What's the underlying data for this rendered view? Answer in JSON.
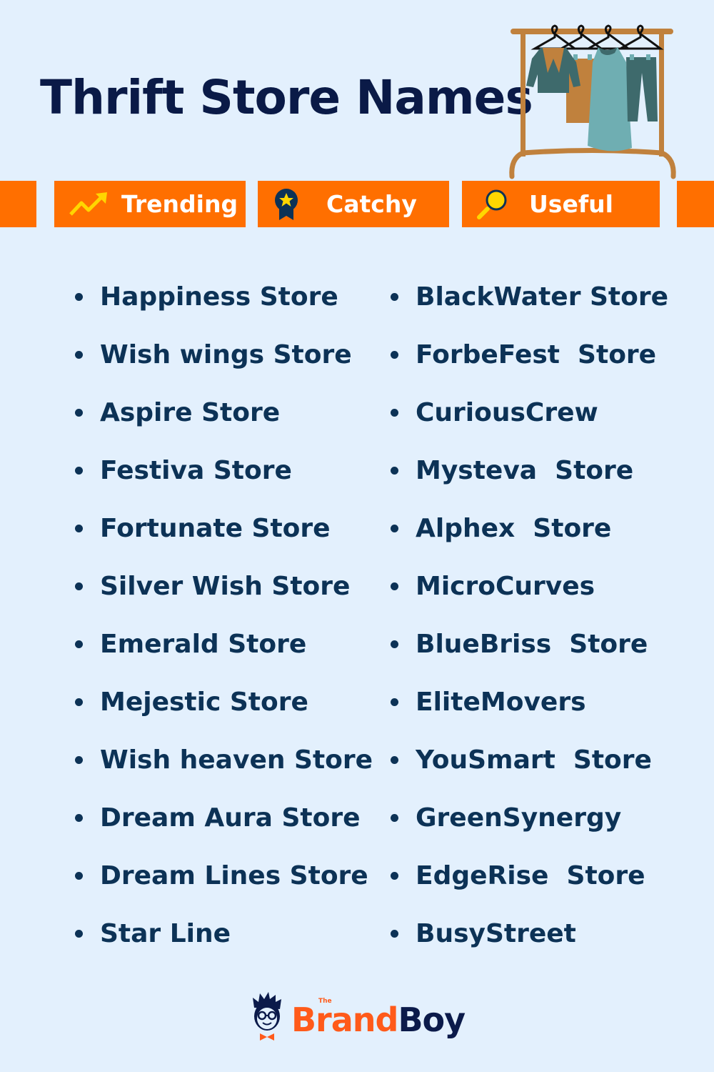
{
  "header": {
    "title": "Thrift Store Names",
    "illustration": "clothes-rack-icon"
  },
  "tabs": [
    {
      "label": "Trending",
      "icon": "trending-arrow-icon"
    },
    {
      "label": "Catchy",
      "icon": "award-star-icon"
    },
    {
      "label": "Useful",
      "icon": "magnifier-icon"
    }
  ],
  "names": {
    "left": [
      "Happiness Store",
      "Wish wings Store",
      "Aspire Store",
      "Festiva Store",
      "Fortunate Store",
      "Silver Wish Store",
      "Emerald Store",
      "Mejestic Store",
      "Wish heaven Store",
      "Dream Aura Store",
      "Dream Lines Store",
      "Star Line"
    ],
    "right": [
      "BlackWater Store",
      "ForbeFest  Store",
      "CuriousCrew",
      "Mysteva  Store",
      "Alphex  Store",
      "MicroCurves",
      "BlueBriss  Store",
      "EliteMovers",
      "YouSmart  Store",
      "GreenSynergy",
      "EdgeRise  Store",
      "BusyStreet"
    ]
  },
  "logo": {
    "prefix": "The",
    "brand": "Brand",
    "suffix": "Boy"
  },
  "colors": {
    "background": "#e3f0fd",
    "accent": "#ff6f00",
    "title": "#0a1a47",
    "text": "#0c3256"
  }
}
